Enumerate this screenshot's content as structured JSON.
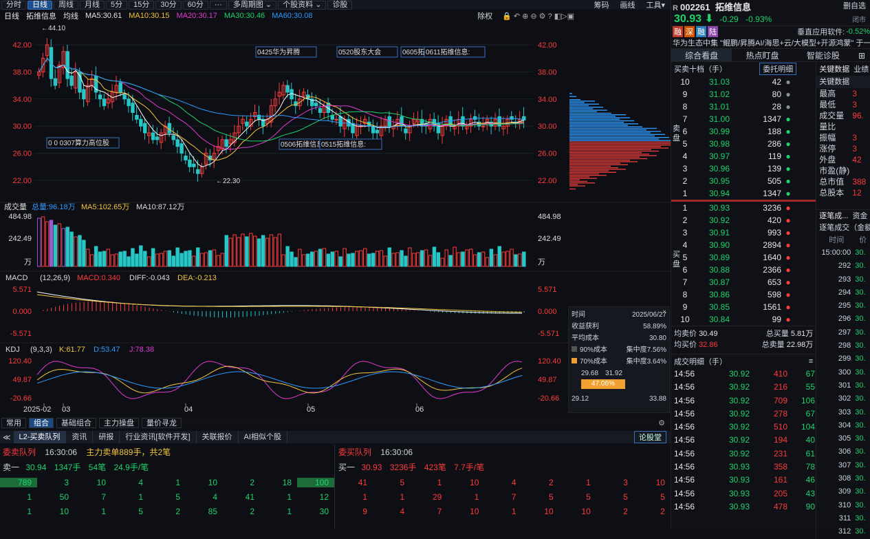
{
  "toolbar": {
    "periods": [
      "分时",
      "日线",
      "周线",
      "月线",
      "5分",
      "15分",
      "30分",
      "60分",
      "···",
      "多周期图 ⌄",
      "个股资料 ⌄",
      "诊股"
    ],
    "right_items": [
      "筹码",
      "画线",
      "工具▾"
    ],
    "active_period": "日线"
  },
  "subbar": {
    "period": "日线",
    "name": "拓维信息",
    "mode": "均线",
    "ma5": "MA5:30.61",
    "ma10": "MA10:30.15",
    "ma20": "MA20:30.17",
    "ma30": "MA30:30.46",
    "ma60": "MA60:30.08",
    "fuquan": "除权"
  },
  "price_axis": [
    "42.00",
    "38.00",
    "34.00",
    "30.00",
    "26.00",
    "22.00"
  ],
  "price_high_label": "←44.10",
  "price_low_label": "←22.30",
  "annotations": [
    "0425华为昇腾",
    "0520股东大会",
    "0605拓",
    "0611拓维信息:",
    "0 0 0307算力高位股",
    "0506拓维信息",
    "0515拓维信息:"
  ],
  "volume": {
    "label": "成交量",
    "total": "总量:96.18万",
    "ma5": "MA5:102.65万",
    "ma10": "MA10:87.12万",
    "axis": [
      "484.98",
      "242.49",
      "万"
    ]
  },
  "macd": {
    "label": "MACD",
    "params": "(12,26,9)",
    "macd": "MACD:0.340",
    "diff": "DIFF:-0.043",
    "dea": "DEA:-0.213",
    "axis": [
      "5.571",
      "0.000",
      "-5.571"
    ]
  },
  "kdj": {
    "label": "KDJ",
    "params": "(9,3,3)",
    "k": "K:61.77",
    "d": "D:53.47",
    "j": "J:78.38",
    "axis": [
      "120.40",
      "49.87",
      "-20.66"
    ]
  },
  "date_axis": [
    "2025-02",
    "03",
    "04",
    "05",
    "06"
  ],
  "chip_panel": {
    "date_label": "时间",
    "date": "2025/06/27",
    "profit_label": "收益获利",
    "profit": "58.89%",
    "avg_label": "平均成本",
    "avg": "30.80",
    "c90_label": "90%成本",
    "c90_conc": "集中度7.56%",
    "c70_label": "70%成本",
    "c70_conc": "集中度3.64%",
    "range_low": "29.68",
    "range_high": "31.92",
    "range_pct": "47.06%",
    "bottom_low": "29.12",
    "bottom_high": "33.88"
  },
  "bottom_tabs": {
    "tabs": [
      "常用",
      "组合",
      "基础组合",
      "主力操盘",
      "量价寻龙"
    ],
    "active": "组合"
  },
  "l2_tabs": {
    "tabs": [
      "L2-买卖队列",
      "资讯",
      "研报",
      "行业资讯[软件开发]",
      "关联报价",
      "AI相似个股"
    ],
    "right": "论股堂"
  },
  "sell_queue": {
    "title": "委卖队列",
    "time": "16:30:06",
    "note": "主力卖单889手，共2笔",
    "level": "卖一",
    "price": "30.94",
    "vol": "1347手",
    "count": "54笔",
    "avg": "24.9手/笔",
    "rows": [
      [
        "789",
        "3",
        "10",
        "4",
        "1",
        "10",
        "2",
        "18",
        "100"
      ],
      [
        "1",
        "50",
        "7",
        "1",
        "5",
        "4",
        "41",
        "1",
        "12"
      ],
      [
        "1",
        "10",
        "1",
        "5",
        "2",
        "85",
        "2",
        "1",
        "30"
      ]
    ]
  },
  "buy_queue": {
    "title": "委买队列",
    "time": "16:30:06",
    "level": "买一",
    "price": "30.93",
    "vol": "3236手",
    "count": "423笔",
    "avg": "7.7手/笔",
    "rows": [
      [
        "41",
        "5",
        "1",
        "10",
        "4",
        "2",
        "1",
        "3",
        "10"
      ],
      [
        "1",
        "1",
        "29",
        "1",
        "7",
        "5",
        "5",
        "5",
        "5"
      ],
      [
        "9",
        "4",
        "7",
        "10",
        "1",
        "10",
        "10",
        "2",
        "2"
      ]
    ]
  },
  "quote": {
    "code": "002261",
    "name": "拓维信息",
    "price": "30.93",
    "change": "-0.29",
    "pct": "-0.93%",
    "tags": [
      "融",
      "深",
      "融",
      "陆"
    ],
    "concept_label": "垂直应用软件:",
    "concept_pct": "-0.52%",
    "news": "华为生态中集 \"鲲鹏/昇腾AI/海思+云/大模型+开源鸿蒙\" 于一...",
    "tabs": [
      "综合看盘",
      "热点盯盘",
      "智能诊股"
    ],
    "right_btns": [
      "删自选",
      "闭市"
    ]
  },
  "orderbook": {
    "title": "买卖十档（手）",
    "btn": "委托明细",
    "sell": [
      [
        "10",
        "31.03",
        "42"
      ],
      [
        "9",
        "31.02",
        "80"
      ],
      [
        "8",
        "31.01",
        "28"
      ],
      [
        "7",
        "31.00",
        "1347"
      ],
      [
        "6",
        "30.99",
        "188"
      ],
      [
        "5",
        "30.98",
        "286"
      ],
      [
        "4",
        "30.97",
        "119"
      ],
      [
        "3",
        "30.96",
        "139"
      ],
      [
        "2",
        "30.95",
        "505"
      ],
      [
        "1",
        "30.94",
        "1347"
      ]
    ],
    "buy": [
      [
        "1",
        "30.93",
        "3236"
      ],
      [
        "2",
        "30.92",
        "420"
      ],
      [
        "3",
        "30.91",
        "993"
      ],
      [
        "4",
        "30.90",
        "2894"
      ],
      [
        "5",
        "30.89",
        "1640"
      ],
      [
        "6",
        "30.88",
        "2366"
      ],
      [
        "7",
        "30.87",
        "653"
      ],
      [
        "8",
        "30.86",
        "598"
      ],
      [
        "9",
        "30.85",
        "1561"
      ],
      [
        "10",
        "30.84",
        "99"
      ]
    ],
    "sell_side": "卖盘",
    "buy_side": "买盘",
    "avg_sell_label": "均卖价",
    "avg_sell": "30.49",
    "total_sell_label": "总买量",
    "total_sell": "5.81万",
    "avg_buy_label": "均买价",
    "avg_buy": "32.86",
    "total_buy_label": "总卖量",
    "total_buy": "22.98万"
  },
  "key_data": {
    "tab": "关键数据",
    "tab2": "业绩",
    "title": "关键数据",
    "rows": [
      [
        "最高",
        "3"
      ],
      [
        "最低",
        "3"
      ],
      [
        "成交量",
        "96."
      ],
      [
        "量比",
        ""
      ],
      [
        "振幅",
        "3"
      ],
      [
        "涨停",
        "3"
      ],
      [
        "外盘",
        "42"
      ],
      [
        "市盈(静)",
        ""
      ],
      [
        "总市值",
        "388"
      ],
      [
        "总股本",
        "12"
      ]
    ]
  },
  "trades": {
    "title": "成交明细（手）",
    "rows": [
      [
        "14:56",
        "30.92",
        "410",
        "67"
      ],
      [
        "14:56",
        "30.92",
        "216",
        "55"
      ],
      [
        "14:56",
        "30.92",
        "709",
        "106"
      ],
      [
        "14:56",
        "30.92",
        "278",
        "67"
      ],
      [
        "14:56",
        "30.92",
        "510",
        "104"
      ],
      [
        "14:56",
        "30.92",
        "194",
        "40"
      ],
      [
        "14:56",
        "30.92",
        "231",
        "61"
      ],
      [
        "14:56",
        "30.93",
        "358",
        "78"
      ],
      [
        "14:56",
        "30.93",
        "161",
        "46"
      ],
      [
        "14:56",
        "30.93",
        "205",
        "43"
      ],
      [
        "14:56",
        "30.93",
        "478",
        "90"
      ]
    ]
  },
  "tick": {
    "tab": "逐笔成...",
    "tab2": "资金",
    "sub": "逐笔成交（金额",
    "time_label": "时间",
    "price_label": "价",
    "rows": [
      [
        "15:00:00",
        "30."
      ],
      [
        "292",
        "30."
      ],
      [
        "293",
        "30."
      ],
      [
        "294",
        "30."
      ],
      [
        "295",
        "30."
      ],
      [
        "296",
        "30."
      ],
      [
        "297",
        "30."
      ],
      [
        "298",
        "30."
      ],
      [
        "299",
        "30."
      ],
      [
        "300",
        "30."
      ],
      [
        "301",
        "30."
      ],
      [
        "302",
        "30."
      ],
      [
        "303",
        "30."
      ],
      [
        "304",
        "30."
      ],
      [
        "305",
        "30."
      ],
      [
        "306",
        "30."
      ],
      [
        "307",
        "30."
      ],
      [
        "308",
        "30."
      ],
      [
        "309",
        "30."
      ],
      [
        "310",
        "30."
      ],
      [
        "311",
        "30."
      ],
      [
        "312",
        "30."
      ]
    ]
  }
}
